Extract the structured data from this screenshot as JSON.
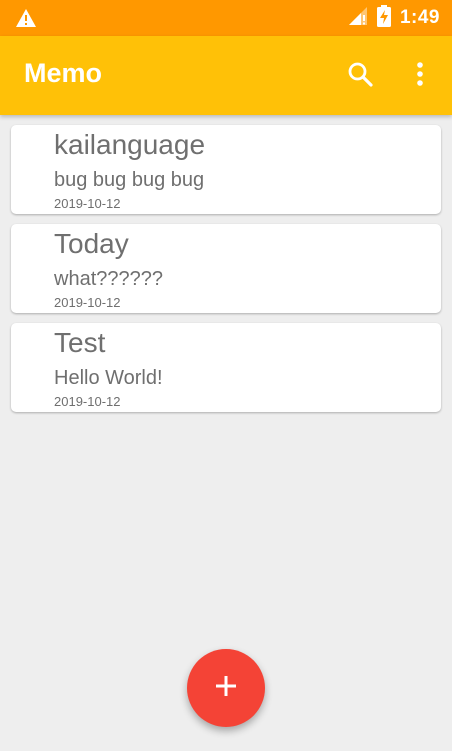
{
  "status_bar": {
    "time": "1:49",
    "icons": [
      "warning-icon",
      "signal-icon",
      "battery-charging-icon"
    ]
  },
  "app_bar": {
    "title": "Memo",
    "actions": [
      "search-icon",
      "more-vert-icon"
    ]
  },
  "memos": [
    {
      "title": "kailanguage",
      "content": "bug bug bug bug",
      "date": "2019-10-12"
    },
    {
      "title": "Today",
      "content": "what??????",
      "date": "2019-10-12"
    },
    {
      "title": "Test",
      "content": "Hello World!",
      "date": "2019-10-12"
    }
  ],
  "fab": {
    "icon": "add-icon"
  },
  "colors": {
    "status_bar": "#ff9800",
    "app_bar": "#ffc107",
    "fab": "#f44336",
    "background": "#eeeeee",
    "card": "#ffffff",
    "text_secondary": "#6f6f6f"
  }
}
